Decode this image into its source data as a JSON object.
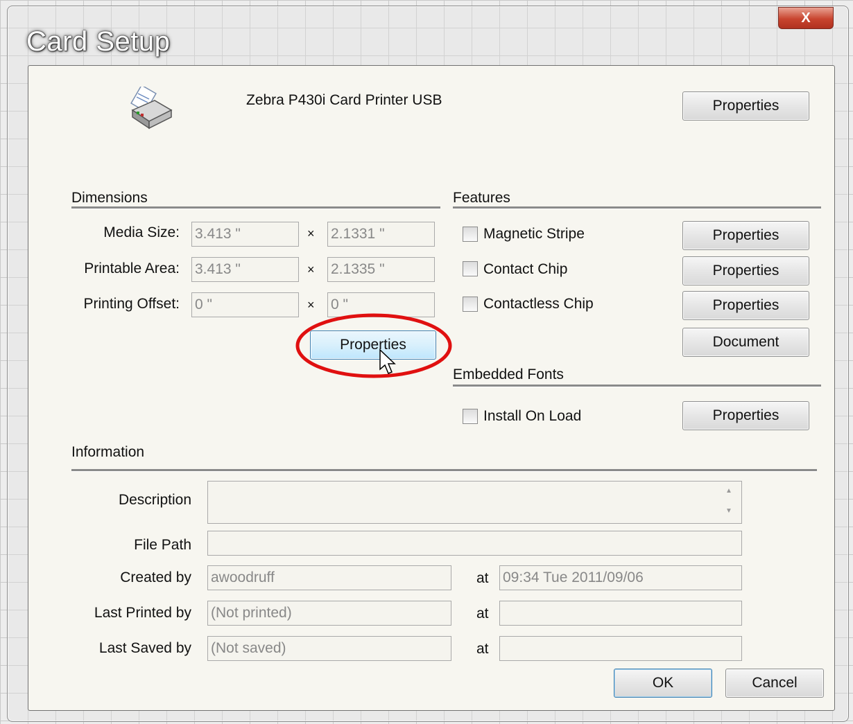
{
  "window": {
    "title": "Card Setup",
    "close_glyph": "X"
  },
  "printer": {
    "name": "Zebra P430i Card Printer USB",
    "properties_label": "Properties",
    "icon": "printer-icon"
  },
  "dimensions": {
    "section_label": "Dimensions",
    "times_glyph": "×",
    "rows": [
      {
        "label": "Media Size:",
        "width": "3.413 \"",
        "height": "2.1331 \""
      },
      {
        "label": "Printable Area:",
        "width": "3.413 \"",
        "height": "2.1335 \""
      },
      {
        "label": "Printing Offset:",
        "width": "0 \"",
        "height": "0 \""
      }
    ],
    "properties_label": "Properties",
    "highlight_color": "#e01010"
  },
  "features": {
    "section_label": "Features",
    "items": [
      {
        "label": "Magnetic Stripe",
        "checked": false,
        "button": "Properties"
      },
      {
        "label": "Contact Chip",
        "checked": false,
        "button": "Properties"
      },
      {
        "label": "Contactless Chip",
        "checked": false,
        "button": "Properties"
      }
    ],
    "document_label": "Document"
  },
  "embedded_fonts": {
    "section_label": "Embedded Fonts",
    "install_label": "Install On Load",
    "checked": false,
    "properties_label": "Properties"
  },
  "information": {
    "section_label": "Information",
    "description_label": "Description",
    "description_value": "",
    "file_path_label": "File Path",
    "file_path_value": "",
    "at_label": "at",
    "created_by_label": "Created by",
    "created_by_value": "awoodruff",
    "created_at_value": "09:34 Tue 2011/09/06",
    "last_printed_label": "Last Printed by",
    "last_printed_value": "(Not printed)",
    "last_printed_at": "",
    "last_saved_label": "Last Saved by",
    "last_saved_value": "(Not saved)",
    "last_saved_at": ""
  },
  "footer": {
    "ok_label": "OK",
    "cancel_label": "Cancel"
  },
  "colors": {
    "accent": "#3c7fb1",
    "close_red": "#c8442e"
  }
}
